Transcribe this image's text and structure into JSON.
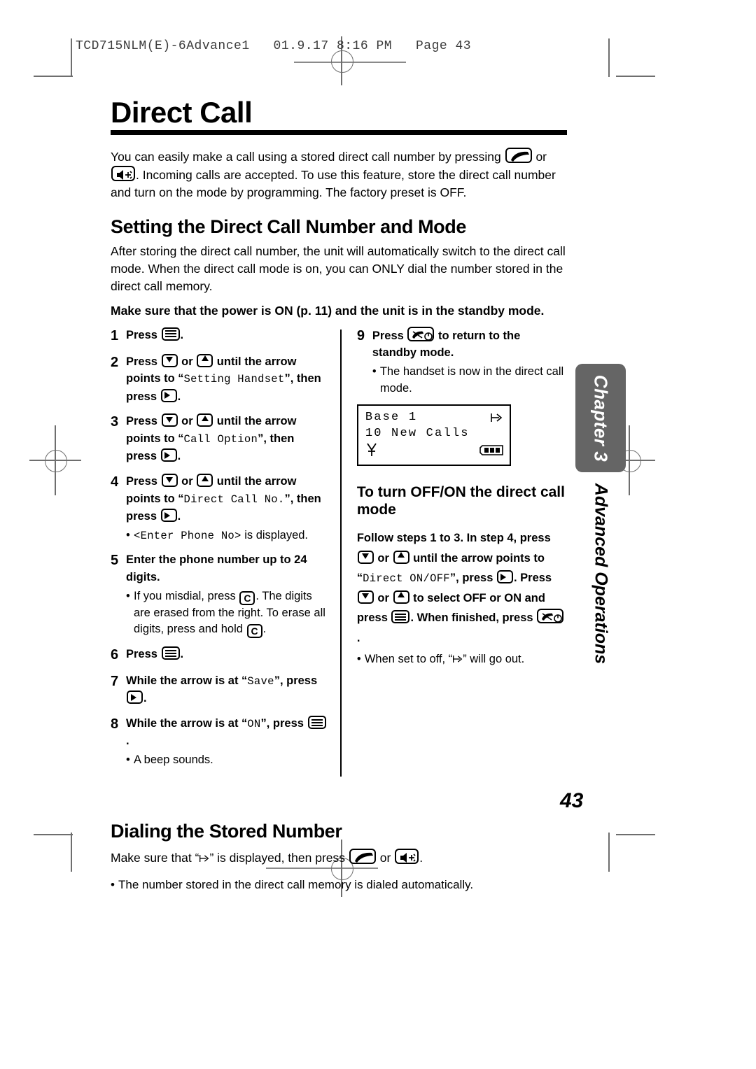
{
  "slug": "TCD715NLM(E)-6Advance1   01.9.17 8:16 PM   Page 43",
  "page_title": "Direct Call",
  "intro": "You can easily make a call using a stored direct call number by pressing ",
  "intro_mid": " or ",
  "intro_end": ". Incoming calls are accepted. To use this feature, store the direct call number and turn on the mode by programming. The factory preset is OFF.",
  "section": {
    "heading": "Setting the Direct Call Number and Mode",
    "body": "After storing the direct call number, the unit will automatically switch to the direct call mode. When the direct call mode is on, you can ONLY dial the number stored in the direct call memory.",
    "note": "Make sure that the power is ON (p. 11) and the unit is in the standby mode."
  },
  "steps_left": {
    "s1_num": "1",
    "s1_a": "Press ",
    "s1_b": ".",
    "s2_num": "2",
    "s2_a": "Press ",
    "s2_b": " or ",
    "s2_c": " until the arrow points to “",
    "s2_lcd": "Setting Handset",
    "s2_d": "”, then press ",
    "s2_e": ".",
    "s3_num": "3",
    "s3_a": "Press ",
    "s3_b": " or ",
    "s3_c": " until the arrow points to “",
    "s3_lcd": "Call Option",
    "s3_d": "”, then press ",
    "s3_e": ".",
    "s4_num": "4",
    "s4_a": "Press ",
    "s4_b": " or ",
    "s4_c": " until the arrow points to “",
    "s4_lcd": "Direct Call No.",
    "s4_d": "”, then press ",
    "s4_e": ".",
    "s4_bullet_lcd": "<Enter Phone No>",
    "s4_bullet_text": " is displayed.",
    "s5_num": "5",
    "s5_a": "Enter the phone number up to 24 digits.",
    "s5_b1": "If you misdial, press ",
    "s5_b2": ". The digits are erased from the right. To erase all digits, press and hold ",
    "s5_b3": ".",
    "s6_num": "6",
    "s6_a": "Press ",
    "s6_b": ".",
    "s7_num": "7",
    "s7_a": "While the arrow is at “",
    "s7_lcd": "Save",
    "s7_b": "”, press ",
    "s7_c": ".",
    "s8_num": "8",
    "s8_a": "While the arrow is at “",
    "s8_lcd": "ON",
    "s8_b": "”, press ",
    "s8_c": ".",
    "s8_bullet": "A beep sounds."
  },
  "steps_right": {
    "s9_num": "9",
    "s9_a": "Press ",
    "s9_b": " to return to the standby mode.",
    "s9_bullet": "The handset is now in the direct call mode."
  },
  "lcd": {
    "line1": "Base 1",
    "line2": "10 New Calls",
    "direct_call_icon": "direct-call-arrow",
    "antenna_icon": "antenna-icon",
    "battery_icon": "battery-full-icon"
  },
  "subsection": {
    "heading": "To turn OFF/ON the direct call mode",
    "t1": "Follow steps 1 to 3. In step 4, press ",
    "t2": " or ",
    "t3": " until the arrow points to “",
    "t3_lcd": "Direct ON/OFF",
    "t4": "”, press ",
    "t5": ". Press ",
    "t6": " or ",
    "t7": " to select OFF or ON and press ",
    "t8": ". When finished, press ",
    "t9": ".",
    "bullet_a": "When set to off, “",
    "bullet_b": "” will go out."
  },
  "dialing": {
    "heading": "Dialing the Stored Number",
    "line_a": "Make sure that “",
    "line_b": "” is displayed, then press ",
    "line_c": " or ",
    "line_d": ".",
    "bullet": "The number stored in the direct call memory is dialed automatically."
  },
  "chapter": {
    "tab_label": "Chapter 3",
    "sub_label": "Advanced Operations",
    "tab_color": "#656565"
  },
  "page_number": "43"
}
